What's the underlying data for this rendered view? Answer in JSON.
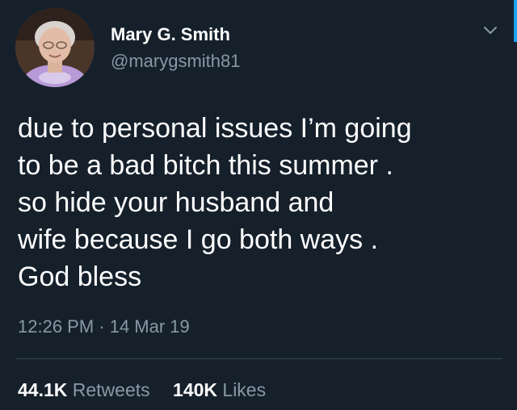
{
  "user": {
    "name": "Mary G. Smith",
    "handle": "@marygsmith81"
  },
  "tweet": {
    "lines": [
      "due to personal issues I’m going",
      "to be a bad bitch this summer .",
      "so hide your husband and",
      "wife because I go both ways .",
      "God bless"
    ],
    "timestamp": "12:26 PM · 14 Mar 19"
  },
  "stats": {
    "retweets_count": "44.1K",
    "retweets_label": "Retweets",
    "likes_count": "140K",
    "likes_label": "Likes"
  },
  "icons": {
    "menu": "chevron-down-icon"
  },
  "colors": {
    "background": "#15202b",
    "secondary_text": "#8899a6",
    "accent": "#1da1f2"
  }
}
